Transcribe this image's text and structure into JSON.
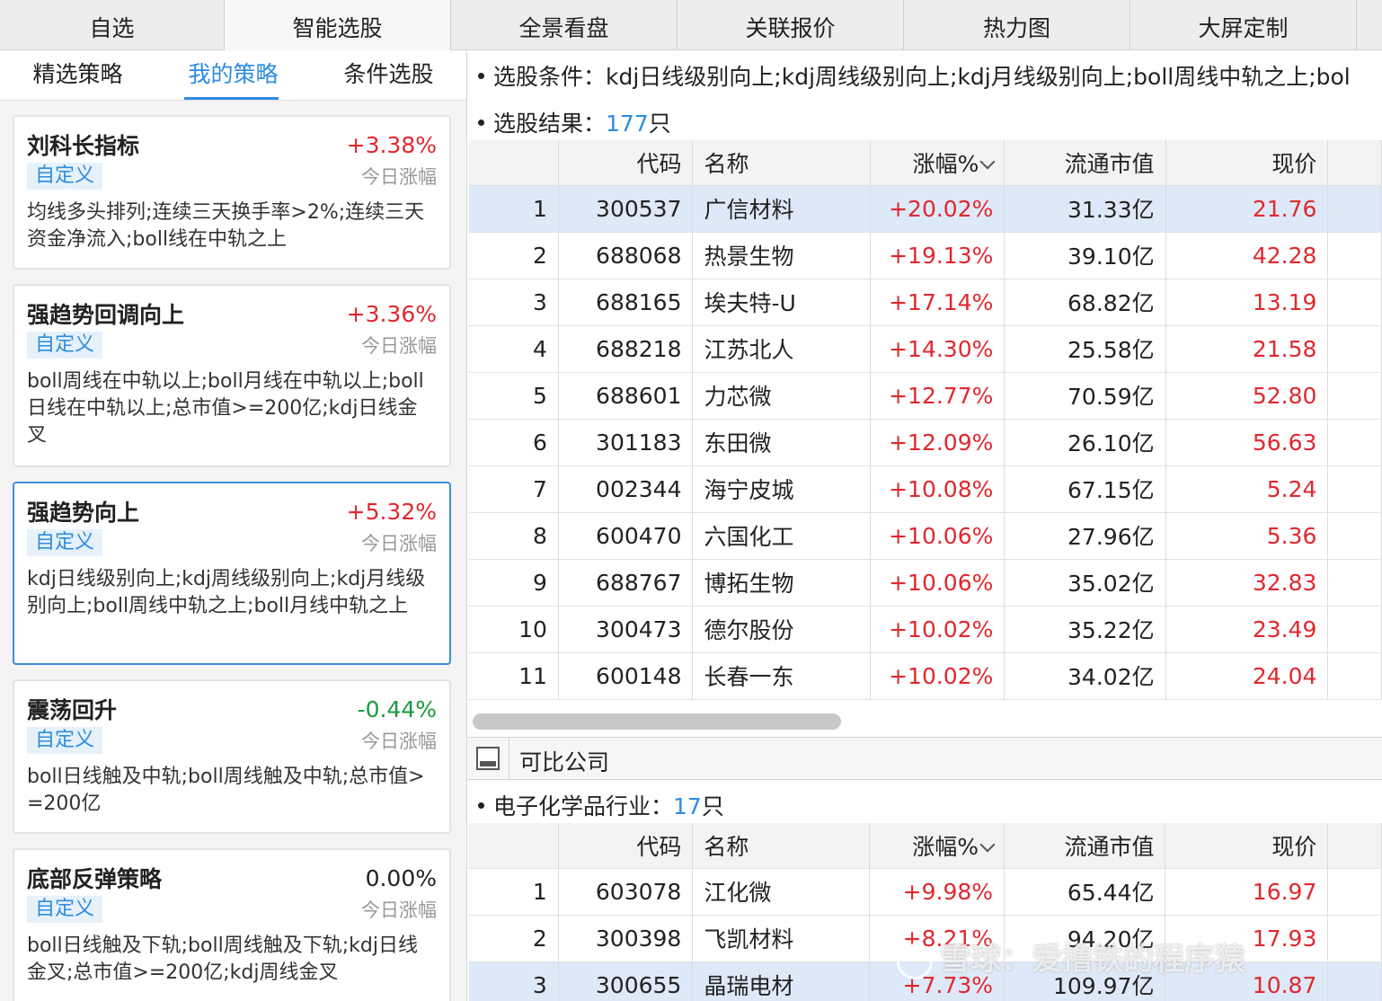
{
  "top_tabs": [
    "自选",
    "智能选股",
    "全景看盘",
    "关联报价",
    "热力图",
    "大屏定制"
  ],
  "sub_tabs": [
    "精选策略",
    "我的策略",
    "条件选股"
  ],
  "strategies": [
    {
      "name": "刘科长指标",
      "change": "+3.38%",
      "tag": "自定义",
      "sub": "今日涨幅",
      "desc": "均线多头排列;连续三天换手率>2%;连续三天资金净流入;boll线在中轨之上"
    },
    {
      "name": "强趋势回调向上",
      "change": "+3.36%",
      "tag": "自定义",
      "sub": "今日涨幅",
      "desc": "boll周线在中轨以上;boll月线在中轨以上;boll日线在中轨以上;总市值>=200亿;kdj日线金叉"
    },
    {
      "name": "强趋势向上",
      "change": "+5.32%",
      "tag": "自定义",
      "sub": "今日涨幅",
      "desc": "kdj日线级别向上;kdj周线级别向上;kdj月线级别向上;boll周线中轨之上;boll月线中轨之上"
    },
    {
      "name": "震荡回升",
      "change": "-0.44%",
      "tag": "自定义",
      "sub": "今日涨幅",
      "desc": "boll日线触及中轨;boll周线触及中轨;总市值>=200亿"
    },
    {
      "name": "底部反弹策略",
      "change": "0.00%",
      "tag": "自定义",
      "sub": "今日涨幅",
      "desc": "boll日线触及下轨;boll周线触及下轨;kdj日线金叉;总市值>=200亿;kdj周线金叉"
    }
  ],
  "conditions": {
    "label": "选股条件：",
    "value": "kdj日线级别向上;kdj周线级别向上;kdj月线级别向上;boll周线中轨之上;bol"
  },
  "result": {
    "label": "选股结果：",
    "count": "177",
    "unit": "只"
  },
  "columns": {
    "code": "代码",
    "name": "名称",
    "change": "涨幅%",
    "cap": "流通市值",
    "price": "现价"
  },
  "rows": [
    {
      "idx": "1",
      "code": "300537",
      "name": "广信材料",
      "change": "+20.02%",
      "cap": "31.33亿",
      "price": "21.76"
    },
    {
      "idx": "2",
      "code": "688068",
      "name": "热景生物",
      "change": "+19.13%",
      "cap": "39.10亿",
      "price": "42.28"
    },
    {
      "idx": "3",
      "code": "688165",
      "name": "埃夫特-U",
      "change": "+17.14%",
      "cap": "68.82亿",
      "price": "13.19"
    },
    {
      "idx": "4",
      "code": "688218",
      "name": "江苏北人",
      "change": "+14.30%",
      "cap": "25.58亿",
      "price": "21.58"
    },
    {
      "idx": "5",
      "code": "688601",
      "name": "力芯微",
      "change": "+12.77%",
      "cap": "70.59亿",
      "price": "52.80"
    },
    {
      "idx": "6",
      "code": "301183",
      "name": "东田微",
      "change": "+12.09%",
      "cap": "26.10亿",
      "price": "56.63"
    },
    {
      "idx": "7",
      "code": "002344",
      "name": "海宁皮城",
      "change": "+10.08%",
      "cap": "67.15亿",
      "price": "5.24"
    },
    {
      "idx": "8",
      "code": "600470",
      "name": "六国化工",
      "change": "+10.06%",
      "cap": "27.96亿",
      "price": "5.36"
    },
    {
      "idx": "9",
      "code": "688767",
      "name": "博拓生物",
      "change": "+10.06%",
      "cap": "35.02亿",
      "price": "32.83"
    },
    {
      "idx": "10",
      "code": "300473",
      "name": "德尔股份",
      "change": "+10.02%",
      "cap": "35.22亿",
      "price": "23.49"
    },
    {
      "idx": "11",
      "code": "600148",
      "name": "长春一东",
      "change": "+10.02%",
      "cap": "34.02亿",
      "price": "24.04"
    }
  ],
  "comparable": {
    "title": "可比公司",
    "industry_label": "电子化学品行业：",
    "industry_count": "17",
    "industry_unit": "只",
    "rows": [
      {
        "idx": "1",
        "code": "603078",
        "name": "江化微",
        "change": "+9.98%",
        "cap": "65.44亿",
        "price": "16.97"
      },
      {
        "idx": "2",
        "code": "300398",
        "name": "飞凯材料",
        "change": "+8.21%",
        "cap": "94.20亿",
        "price": "17.93"
      },
      {
        "idx": "3",
        "code": "300655",
        "name": "晶瑞电材",
        "change": "+7.73%",
        "cap": "109.97亿",
        "price": "10.87"
      }
    ]
  },
  "watermark": "雪球：爱撸铁的程序猿",
  "colors": {
    "up": "#e0282e",
    "down": "#1a9a3e",
    "accent": "#2d8ce0",
    "highlight": "#dde9f8"
  }
}
